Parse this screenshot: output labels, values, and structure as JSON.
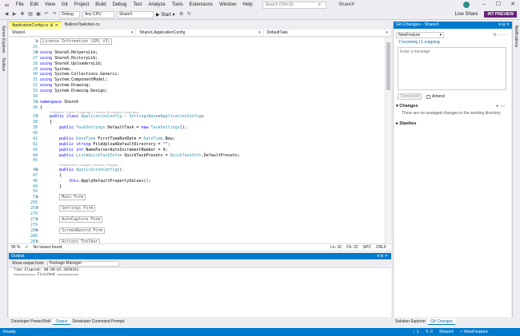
{
  "menu": [
    "File",
    "Edit",
    "View",
    "Git",
    "Project",
    "Build",
    "Debug",
    "Test",
    "Analyze",
    "Tools",
    "Extensions",
    "Window",
    "Help"
  ],
  "search_placeholder": "Search (Ctrl+Q)",
  "app_title": "ShareX",
  "toolbar": {
    "config": "Debug",
    "platform": "Any CPU",
    "project": "ShareX",
    "start_label": "▶ Start ▾",
    "live_share": "Live Share",
    "int_preview": "INT PREVIEW"
  },
  "left_tabs": [
    "Server Explorer",
    "Toolbox"
  ],
  "right_tabs": [
    "Notifications"
  ],
  "doc_tabs": [
    {
      "label": "ApplicationConfig.cs",
      "active": true
    },
    {
      "label": "BalloonTipAction.cs",
      "active": false
    }
  ],
  "nav": {
    "project": "ShareX",
    "class": "ShareX.ApplicationConfig",
    "member": "DefaultTask"
  },
  "code_lines": [
    {
      "n": "1",
      "fold": "+",
      "text": "License Information (GPL v3)",
      "box": true
    },
    {
      "n": "25",
      "text": ""
    },
    {
      "n": "26",
      "fold": "-",
      "text": "using ShareX.HelpersLib;"
    },
    {
      "n": "27",
      "text": "using ShareX.HistoryLib;"
    },
    {
      "n": "28",
      "text": "using ShareX.UploadersLib;"
    },
    {
      "n": "29",
      "text": "using System;"
    },
    {
      "n": "30",
      "text": "using System.Collections.Generic;"
    },
    {
      "n": "31",
      "text": "using System.ComponentModel;"
    },
    {
      "n": "32",
      "text": "using System.Drawing;"
    },
    {
      "n": "33",
      "text": "using System.Drawing.Design;"
    },
    {
      "n": "34",
      "text": ""
    },
    {
      "n": "35",
      "fold": "-",
      "text": "namespace ShareX"
    },
    {
      "n": "36",
      "text": "{"
    },
    {
      "n": "37",
      "fold": "-",
      "text": "    public class ApplicationConfig : SettingsBase<ApplicationConfig>",
      "lens": "1 reference | Tryxon, 76 days ago | 2 authors, 82 changes | 3 work items"
    },
    {
      "n": "38",
      "text": "    {"
    },
    {
      "n": "39",
      "text": "        public TaskSettings DefaultTask = new TaskSettings();"
    },
    {
      "n": "40",
      "text": ""
    },
    {
      "n": "41",
      "text": "        public DateTime FirstTimeRunDate = DateTime.Now;"
    },
    {
      "n": "42",
      "text": "        public string FileUploadDefaultDirectory = \"\";"
    },
    {
      "n": "43",
      "text": "        public int NameParserAutoIncrementNumber = 0;"
    },
    {
      "n": "44",
      "text": "        public List<QuickTaskInfo> QuickTaskPresets = QuickTaskInfo.DefaultPresets;"
    },
    {
      "n": "45",
      "text": ""
    },
    {
      "n": "46",
      "fold": "-",
      "text": "        public ApplicationConfig()",
      "lens": "0 references | 0 changes | 0 authors, 0 changes"
    },
    {
      "n": "47",
      "text": "        {"
    },
    {
      "n": "48",
      "text": "            this.ApplyDefaultPropertyValues();"
    },
    {
      "n": "49",
      "text": "        }"
    },
    {
      "n": "50",
      "text": ""
    },
    {
      "n": "51",
      "fold": "+",
      "text": "        Main Form",
      "box": true
    },
    {
      "n": "256",
      "text": ""
    },
    {
      "n": "257",
      "fold": "+",
      "text": "        Settings Form",
      "box": true
    },
    {
      "n": "270",
      "text": ""
    },
    {
      "n": "271",
      "fold": "+",
      "text": "        AutoCapture Form",
      "box": true
    },
    {
      "n": "279",
      "text": ""
    },
    {
      "n": "280",
      "fold": "+",
      "text": "        ScreenRecord Form",
      "box": true
    },
    {
      "n": "286",
      "text": ""
    },
    {
      "n": "287",
      "fold": "+",
      "text": "        Actions Toolbar",
      "box": true
    },
    {
      "n": "301",
      "text": ""
    }
  ],
  "editor_status": {
    "zoom": "95 %",
    "issues": "No issues found",
    "ln": "Ln: 32",
    "ch": "Ch: 22",
    "enc": "SPC",
    "eol": "CRLF"
  },
  "output": {
    "title": "Output",
    "show_from_label": "Show output from:",
    "source": "Package Manager",
    "lines": [
      "Time Elapsed: 00:00:01.3050181",
      "========== Finished =========="
    ]
  },
  "bottom_tabs": [
    {
      "label": "Developer PowerShell",
      "active": false
    },
    {
      "label": "Output",
      "active": true
    },
    {
      "label": "Developer Command Prompt",
      "active": false
    }
  ],
  "git": {
    "title": "Git Changes - ShareX",
    "branch": "NewFeature",
    "incoming_outgoing": "2 incoming | 1 outgoing",
    "message_placeholder": "Enter a message",
    "commit_label": "Commit All",
    "amend_label": "Amend",
    "changes_header": "Changes",
    "changes_message": "There are no unstaged changes in the working directory.",
    "stashes_header": "Stashes",
    "tabs": [
      "Solution Explorer",
      "Git Changes"
    ]
  },
  "statusbar": {
    "left": "Ready",
    "items": [
      "↑ 1",
      "✎ 0",
      "ShareX",
      "⑂ NewFeature"
    ]
  },
  "colors": {
    "accent": "#007acc",
    "brand": "#68217a",
    "active_tab": "#fffc94"
  }
}
